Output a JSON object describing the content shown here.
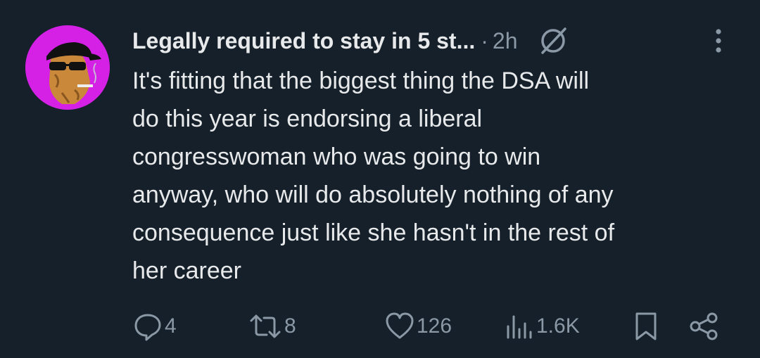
{
  "post": {
    "author_name": "Legally required to stay in 5 st...",
    "separator": "·",
    "time": "2h",
    "text": "It's fitting that the biggest thing the DSA will\ndo this year is endorsing a liberal\ncongresswoman who was going to win\nanyway, who will do absolutely nothing of any\nconsequence just like she hasn't in the rest of\nher career"
  },
  "actions": {
    "replies": "4",
    "reposts": "8",
    "likes": "126",
    "views": "1.6K"
  },
  "icons": {
    "avatar": "cartoon-avatar",
    "badge": "slashed-circle-icon",
    "more": "more-vertical-icon",
    "reply": "reply-icon",
    "repost": "repost-icon",
    "like": "heart-icon",
    "views": "views-icon",
    "bookmark": "bookmark-icon",
    "share": "share-icon"
  },
  "colors": {
    "background": "#15202b",
    "text": "#e7e9ea",
    "muted": "#8b98a5",
    "avatar_bg": "#d521e6"
  }
}
